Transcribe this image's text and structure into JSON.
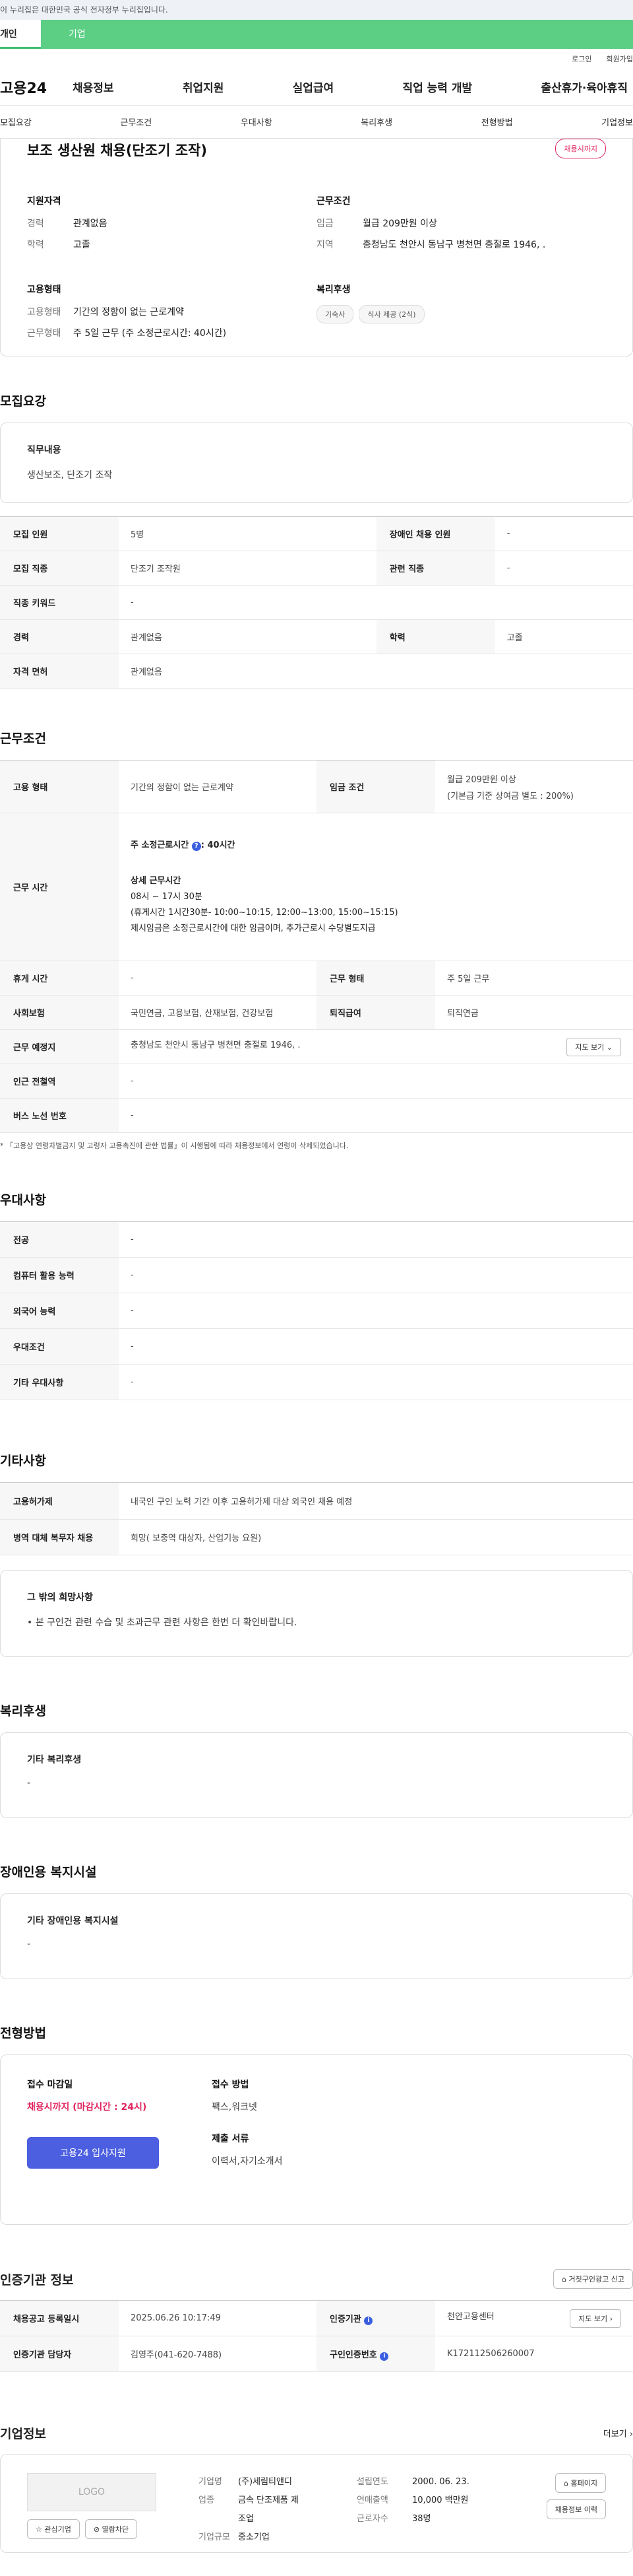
{
  "gov_banner": "이 누리집은 대한민국 공식 전자정부 누리집입니다.",
  "service_tabs": {
    "individual": "개인",
    "company": "기업"
  },
  "util": {
    "login": "로그인",
    "join": "회원가입"
  },
  "gnb": {
    "logo": "고용24",
    "menu": [
      "채용정보",
      "취업지원",
      "실업급여",
      "직업 능력 개발",
      "출산휴가·육아휴직"
    ]
  },
  "tabs": [
    "모집요강",
    "근무조건",
    "우대사항",
    "복리후생",
    "전형방법",
    "기업정보"
  ],
  "job": {
    "title": "보조 생산원 채용(단조기 조작)",
    "badge": "채용시까지",
    "qual": {
      "h": "지원자격",
      "exp_k": "경력",
      "exp_v": "관계없음",
      "edu_k": "학력",
      "edu_v": "고졸"
    },
    "cond": {
      "h": "근무조건",
      "wage_k": "임금",
      "wage_v": "월급 209만원 이상",
      "area_k": "지역",
      "area_v": "충청남도 천안시 동남구 병천면 충절로 1946, ."
    },
    "emp": {
      "h": "고용형태",
      "type_k": "고용형태",
      "type_v": "기간의 정함이 없는 근로계약",
      "form_k": "근무형태",
      "form_v": "주 5일 근무 (주 소정근로시간: 40시간)"
    },
    "welfare": {
      "h": "복리후생",
      "chips": [
        "기숙사",
        "식사 제공 (2식)"
      ]
    }
  },
  "recruit": {
    "title": "모집요강",
    "duty_h": "직무내용",
    "duty_v": "생산보조, 단조기 조작",
    "rows": [
      [
        "모집 인원",
        "5명",
        "장애인 채용 인원",
        "-"
      ],
      [
        "모집 직종",
        "단조기 조작원",
        "관련 직종",
        "-"
      ],
      [
        "직종 키워드",
        "-"
      ],
      [
        "경력",
        "관계없음",
        "학력",
        "고졸"
      ],
      [
        "자격 면허",
        "관계없음"
      ]
    ]
  },
  "work": {
    "title": "근무조건",
    "emp_k": "고용 형태",
    "emp_v": "기간의 정함이 없는 근로계약",
    "wage_k": "임금 조건",
    "wage_v1": "월급 209만원 이상",
    "wage_v2": "(기본급 기준 상여금 별도 : 200%)",
    "time_k": "근무 시간",
    "time_a": "주 소정근로시간 ",
    "time_b": ": 40시간",
    "detail_h": "상세 근무시간",
    "detail_1": "08시 ~ 17시 30분",
    "detail_2": "(휴게시간 1시간30분- 10:00~10:15, 12:00~13:00, 15:00~15:15)",
    "detail_3": "제시임금은 소정근로시간에 대한 임금이며, 추가근로시 수당별도지급",
    "rest_k": "휴게 시간",
    "rest_v": "-",
    "form_k": "근무 형태",
    "form_v": "주 5일 근무",
    "ins_k": "사회보험",
    "ins_v": "국민연금, 고용보험, 산재보험, 건강보험",
    "ret_k": "퇴직급여",
    "ret_v": "퇴직연금",
    "place_k": "근무 예정지",
    "place_v": "충청남도 천안시 동남구 병천면 충절로 1946, .",
    "map_btn": "지도 보기",
    "sub_k": "인근 전철역",
    "sub_v": "-",
    "bus_k": "버스 노선 번호",
    "bus_v": "-",
    "notice": "* 「고용상 연령차별금지 및 고령자 고용촉진에 관한 법률」이 시행됨에 따라 채용정보에서 연령이 삭제되었습니다."
  },
  "pref": {
    "title": "우대사항",
    "rows": [
      [
        "전공",
        "-"
      ],
      [
        "컴퓨터 활용 능력",
        "-"
      ],
      [
        "외국어 능력",
        "-"
      ],
      [
        "우대조건",
        "-"
      ],
      [
        "기타 우대사항",
        "-"
      ]
    ]
  },
  "etc": {
    "title": "기타사항",
    "rows": [
      [
        "고용허가제",
        "내국인 구인 노력 기간 이후 고용허가제 대상 외국인 채용 예정"
      ],
      [
        "병역 대체 복무자 채용",
        "희망( 보충역 대상자, 산업기능 요원)"
      ]
    ],
    "note_h": "그 밖의 희망사항",
    "note_v": "• 본 구인건 관련 수습 및 초과근무 관련 사항은 한번 더 확인바랍니다."
  },
  "welfare": {
    "title": "복리후생",
    "h": "기타 복리후생",
    "v": "-"
  },
  "disab": {
    "title": "장애인용 복지시설",
    "h": "기타 장애인용 복지시설",
    "v": "-"
  },
  "apply": {
    "title": "전형방법",
    "deadline_h": "접수 마감일",
    "deadline_v": "채용시까지 (마감시간 : 24시)",
    "btn": "고용24 입사지원",
    "method_h": "접수 방법",
    "method_v": "팩스,워크넷",
    "doc_h": "제출 서류",
    "doc_v": "이력서,자기소개서"
  },
  "agency": {
    "title": "인증기관 정보",
    "report": "거짓구인광고 신고",
    "r1": [
      "채용공고 등록일시",
      "2025.06.26 10:17:49",
      "인증기관",
      "천안고용센터"
    ],
    "map": "지도 보기",
    "r2": [
      "인증기관 담당자",
      "김영주(041-620-7488)",
      "구인인증번호",
      "K172112506260007"
    ]
  },
  "company": {
    "title": "기업정보",
    "more": "더보기",
    "logo": "LOGO",
    "fav": "관심기업",
    "block": "열람차단",
    "k1": "기업명",
    "v1": "(주)세림티앤디",
    "k2": "업종",
    "v2a": "금속 단조제품 제",
    "v2b": "조업",
    "k3": "기업규모",
    "v3": "중소기업",
    "k4": "설립연도",
    "v4": "2000. 06. 23.",
    "k5": "연매출액",
    "v5": "10,000 백만원",
    "k6": "근로자수",
    "v6": "38명",
    "home": "홈페이지",
    "history": "채용정보 이력"
  }
}
